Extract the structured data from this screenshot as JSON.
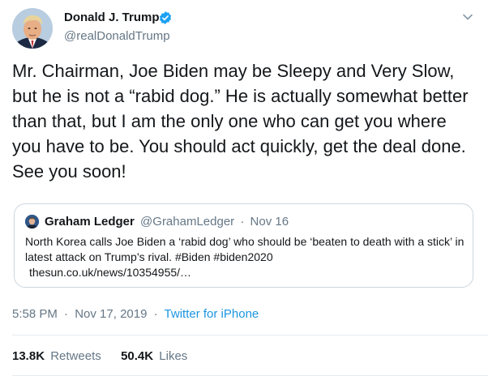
{
  "author": {
    "name": "Donald J. Trump",
    "handle": "@realDonaldTrump"
  },
  "tweet": {
    "text": "Mr. Chairman, Joe Biden may be Sleepy and Very Slow, but he is not a “rabid dog.” He is actually somewhat better than that, but I am the only one who can get you where you have to be. You should act quickly, get the deal done. See you soon!"
  },
  "quote": {
    "name": "Graham Ledger",
    "handle": "@GrahamLedger",
    "separator": "·",
    "date": "Nov 16",
    "text_main": "North Korea calls Joe Biden a ‘rabid dog’ who should be ‘beaten to death with a stick’ in latest attack on Trump’s rival.",
    "hashtags": "#Biden #biden2020",
    "link": "thesun.co.uk/news/10354955/…"
  },
  "meta": {
    "time": "5:58 PM",
    "sep": "·",
    "date": "Nov 17, 2019",
    "source": "Twitter for iPhone"
  },
  "stats": {
    "retweets_count": "13.8K",
    "retweets_label": "Retweets",
    "likes_count": "50.4K",
    "likes_label": "Likes"
  },
  "colors": {
    "verified_badge": "#1da1f2",
    "source_link": "#1b95e0",
    "secondary_text": "#657786",
    "border": "#ccd6dd"
  },
  "icons": {
    "verified": "verified-badge-icon",
    "menu": "chevron-down-icon"
  }
}
